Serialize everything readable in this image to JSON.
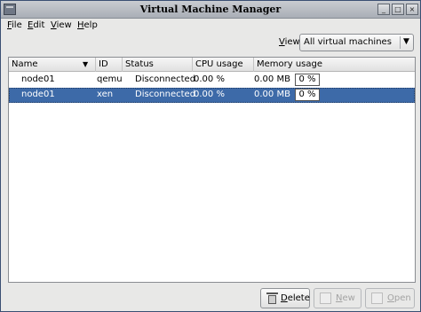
{
  "window": {
    "title": "Virtual Machine Manager"
  },
  "menu": [
    {
      "label": "File",
      "mnemonic": "F",
      "rest": "ile"
    },
    {
      "label": "Edit",
      "mnemonic": "E",
      "rest": "dit"
    },
    {
      "label": "View",
      "mnemonic": "V",
      "rest": "iew"
    },
    {
      "label": "Help",
      "mnemonic": "H",
      "rest": "elp"
    }
  ],
  "filter": {
    "label_mnemonic": "V",
    "label_rest": "iew:",
    "selected": "All virtual machines"
  },
  "table": {
    "columns": [
      "Name",
      "ID",
      "Status",
      "CPU usage",
      "Memory usage"
    ],
    "rows": [
      {
        "name": "node01",
        "id": "qemu",
        "status": "Disconnected",
        "cpu": "0.00 %",
        "memory": "0.00 MB",
        "memory_percent": "0 %",
        "selected": false
      },
      {
        "name": "node01",
        "id": "xen",
        "status": "Disconnected",
        "cpu": "0.00 %",
        "memory": "0.00 MB",
        "memory_percent": "0 %",
        "selected": true
      }
    ]
  },
  "buttons": {
    "delete": {
      "mnemonic": "D",
      "rest": "elete"
    },
    "new": {
      "mnemonic": "N",
      "rest": "ew"
    },
    "open": {
      "mnemonic": "O",
      "rest": "pen"
    }
  },
  "icons": [
    "window-menu-icon",
    "minimize-icon",
    "maximize-icon",
    "close-icon",
    "sort-descending-icon",
    "chevron-down-icon",
    "trash-icon",
    "new-icon",
    "open-icon"
  ]
}
